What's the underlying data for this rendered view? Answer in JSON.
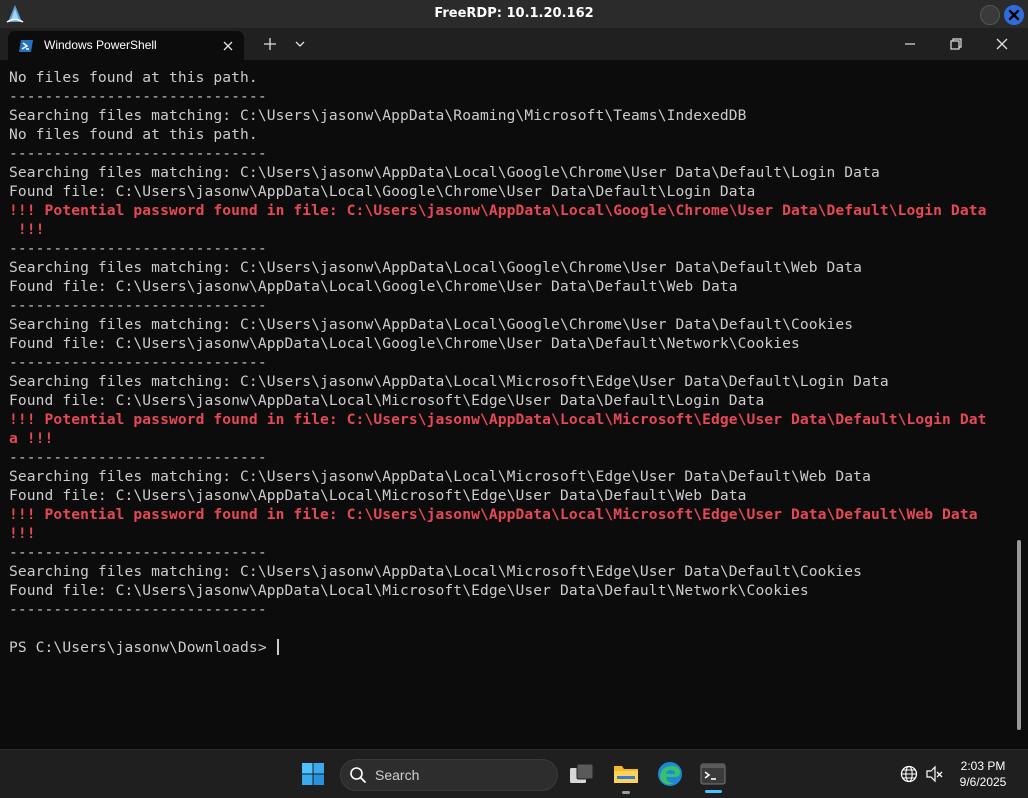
{
  "rdp": {
    "title": "FreeRDP: 10.1.20.162"
  },
  "terminal": {
    "tab_label": "Windows PowerShell",
    "lines": [
      {
        "text": "No files found at this path.",
        "style": "normal"
      },
      {
        "text": "-----------------------------",
        "style": "normal"
      },
      {
        "text": "Searching files matching: C:\\Users\\jasonw\\AppData\\Roaming\\Microsoft\\Teams\\IndexedDB",
        "style": "normal"
      },
      {
        "text": "No files found at this path.",
        "style": "normal"
      },
      {
        "text": "-----------------------------",
        "style": "normal"
      },
      {
        "text": "Searching files matching: C:\\Users\\jasonw\\AppData\\Local\\Google\\Chrome\\User Data\\Default\\Login Data",
        "style": "normal"
      },
      {
        "text": "Found file: C:\\Users\\jasonw\\AppData\\Local\\Google\\Chrome\\User Data\\Default\\Login Data",
        "style": "normal"
      },
      {
        "text": "!!! Potential password found in file: C:\\Users\\jasonw\\AppData\\Local\\Google\\Chrome\\User Data\\Default\\Login Data",
        "style": "red"
      },
      {
        "text": " !!!",
        "style": "red"
      },
      {
        "text": "-----------------------------",
        "style": "normal"
      },
      {
        "text": "Searching files matching: C:\\Users\\jasonw\\AppData\\Local\\Google\\Chrome\\User Data\\Default\\Web Data",
        "style": "normal"
      },
      {
        "text": "Found file: C:\\Users\\jasonw\\AppData\\Local\\Google\\Chrome\\User Data\\Default\\Web Data",
        "style": "normal"
      },
      {
        "text": "-----------------------------",
        "style": "normal"
      },
      {
        "text": "Searching files matching: C:\\Users\\jasonw\\AppData\\Local\\Google\\Chrome\\User Data\\Default\\Cookies",
        "style": "normal"
      },
      {
        "text": "Found file: C:\\Users\\jasonw\\AppData\\Local\\Google\\Chrome\\User Data\\Default\\Network\\Cookies",
        "style": "normal"
      },
      {
        "text": "-----------------------------",
        "style": "normal"
      },
      {
        "text": "Searching files matching: C:\\Users\\jasonw\\AppData\\Local\\Microsoft\\Edge\\User Data\\Default\\Login Data",
        "style": "normal"
      },
      {
        "text": "Found file: C:\\Users\\jasonw\\AppData\\Local\\Microsoft\\Edge\\User Data\\Default\\Login Data",
        "style": "normal"
      },
      {
        "text": "!!! Potential password found in file: C:\\Users\\jasonw\\AppData\\Local\\Microsoft\\Edge\\User Data\\Default\\Login Dat",
        "style": "red"
      },
      {
        "text": "a !!!",
        "style": "red"
      },
      {
        "text": "-----------------------------",
        "style": "normal"
      },
      {
        "text": "Searching files matching: C:\\Users\\jasonw\\AppData\\Local\\Microsoft\\Edge\\User Data\\Default\\Web Data",
        "style": "normal"
      },
      {
        "text": "Found file: C:\\Users\\jasonw\\AppData\\Local\\Microsoft\\Edge\\User Data\\Default\\Web Data",
        "style": "normal"
      },
      {
        "text": "!!! Potential password found in file: C:\\Users\\jasonw\\AppData\\Local\\Microsoft\\Edge\\User Data\\Default\\Web Data",
        "style": "red"
      },
      {
        "text": "!!!",
        "style": "red"
      },
      {
        "text": "-----------------------------",
        "style": "normal"
      },
      {
        "text": "Searching files matching: C:\\Users\\jasonw\\AppData\\Local\\Microsoft\\Edge\\User Data\\Default\\Cookies",
        "style": "normal"
      },
      {
        "text": "Found file: C:\\Users\\jasonw\\AppData\\Local\\Microsoft\\Edge\\User Data\\Default\\Network\\Cookies",
        "style": "normal"
      },
      {
        "text": "-----------------------------",
        "style": "normal"
      },
      {
        "text": "",
        "style": "normal"
      },
      {
        "text": "PS C:\\Users\\jasonw\\Downloads> ",
        "style": "normal"
      }
    ]
  },
  "taskbar": {
    "search_placeholder": "Search",
    "time": "2:03 PM",
    "date": "9/6/2025"
  },
  "colors": {
    "console_bg": "#0c0c0c",
    "console_text": "#cccccc",
    "warning_red": "#e74856",
    "accent_blue": "#4cc2ff"
  },
  "icons": {
    "rdp_logo": "freerdp-logo-icon",
    "tab": "powershell-icon",
    "start": "windows-start-icon",
    "apps": [
      "task-view-icon",
      "file-explorer-icon",
      "edge-icon",
      "terminal-icon"
    ],
    "tray": [
      "language-globe-icon",
      "speaker-muted-icon"
    ]
  }
}
